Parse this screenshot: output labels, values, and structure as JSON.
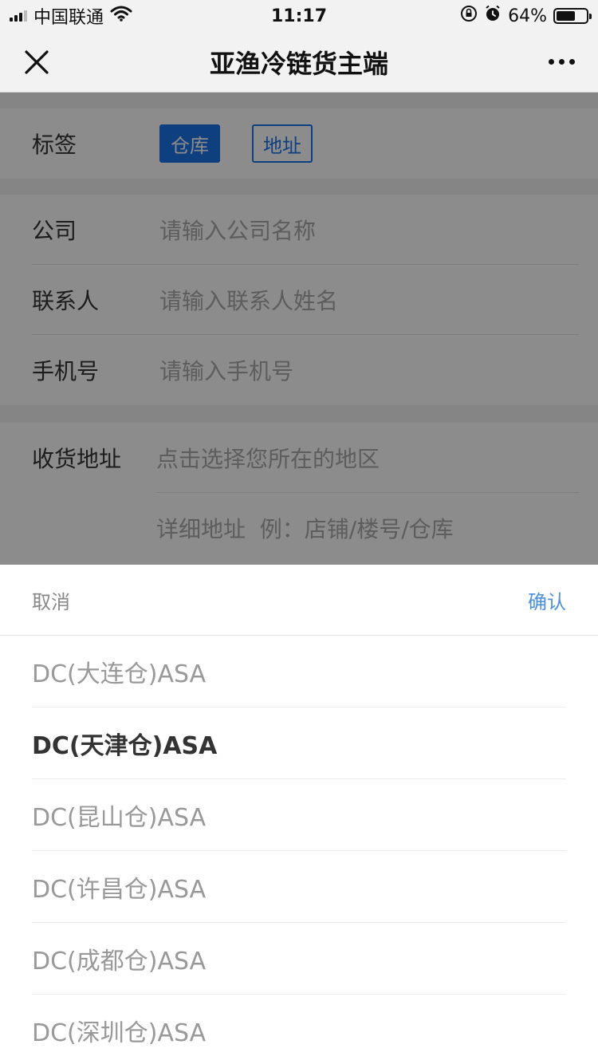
{
  "status_bar": {
    "carrier": "中国联通",
    "time": "11:17",
    "battery": "64%",
    "battery_level": 0.64,
    "icons": [
      "signal-icon",
      "wifi-icon",
      "rotation-lock-icon",
      "alarm-icon",
      "battery-icon"
    ]
  },
  "nav": {
    "title": "亚渔冷链货主端",
    "close_icon": "close-icon",
    "more_icon": "more-icon"
  },
  "form": {
    "tag_label": "标签",
    "tags": [
      {
        "label": "仓库",
        "active": true
      },
      {
        "label": "地址",
        "active": false
      }
    ],
    "company_label": "公司",
    "company_placeholder": "请输入公司名称",
    "contact_label": "联系人",
    "contact_placeholder": "请输入联系人姓名",
    "phone_label": "手机号",
    "phone_placeholder": "请输入手机号",
    "address_label": "收货地址",
    "region_placeholder": "点击选择您所在的地区",
    "detail_placeholder": "详细地址  例：店铺/楼号/仓库"
  },
  "picker": {
    "cancel_label": "取消",
    "confirm_label": "确认",
    "options": [
      {
        "label": "DC(大连仓)ASA",
        "selected": false
      },
      {
        "label": "DC(天津仓)ASA",
        "selected": true
      },
      {
        "label": "DC(昆山仓)ASA",
        "selected": false
      },
      {
        "label": "DC(许昌仓)ASA",
        "selected": false
      },
      {
        "label": "DC(成都仓)ASA",
        "selected": false
      },
      {
        "label": "DC(深圳仓)ASA",
        "selected": false
      }
    ]
  },
  "colors": {
    "accent": "#1a73e8",
    "confirm": "#4a8fe0"
  }
}
